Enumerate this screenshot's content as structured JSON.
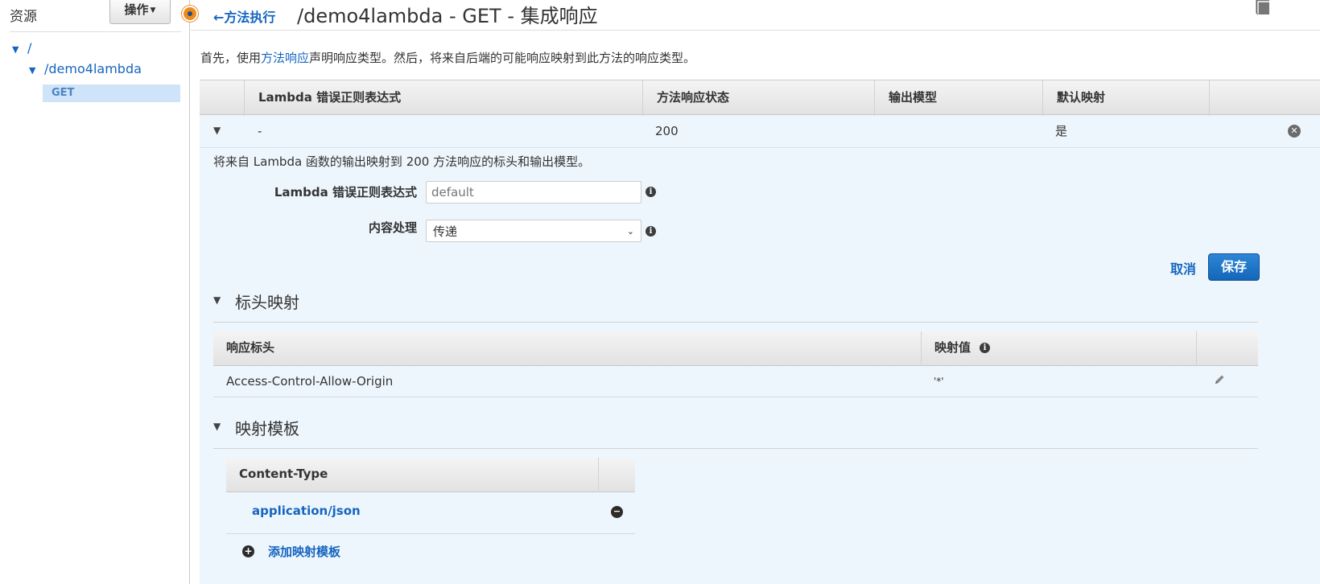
{
  "sidebar": {
    "title": "资源",
    "actions_label": "操作",
    "tree": [
      {
        "label": "/"
      },
      {
        "label": "/demo4lambda"
      },
      {
        "label": "GET",
        "selected": true
      }
    ]
  },
  "header": {
    "back_label": "方法执行",
    "title": "/demo4lambda - GET - 集成响应"
  },
  "intro": {
    "prefix": "首先，使用",
    "link": "方法响应",
    "suffix": "声明响应类型。然后，将来自后端的可能响应映射到此方法的响应类型。"
  },
  "response_table": {
    "columns": [
      "Lambda 错误正则表达式",
      "方法响应状态",
      "输出模型",
      "默认映射"
    ],
    "row": {
      "regex": "-",
      "status": "200",
      "model": "",
      "default": "是"
    }
  },
  "detail": {
    "description": "将来自 Lambda 函数的输出映射到 200 方法响应的标头和输出模型。",
    "regex_label": "Lambda 错误正则表达式",
    "regex_placeholder": "default",
    "content_label": "内容处理",
    "content_value": "传递",
    "cancel_label": "取消",
    "save_label": "保存"
  },
  "header_mappings": {
    "section_title": "标头映射",
    "columns": [
      "响应标头",
      "映射值"
    ],
    "rows": [
      {
        "header": "Access-Control-Allow-Origin",
        "value": "'*'"
      }
    ]
  },
  "mapping_templates": {
    "section_title": "映射模板",
    "column": "Content-Type",
    "rows": [
      {
        "type": "application/json"
      }
    ],
    "add_label": "添加映射模板"
  },
  "colors": {
    "accent": "#1565c0",
    "selected_bg": "#cfe4f8",
    "panel_bg": "#eef6fd",
    "status_dot": "#f08a1c"
  }
}
